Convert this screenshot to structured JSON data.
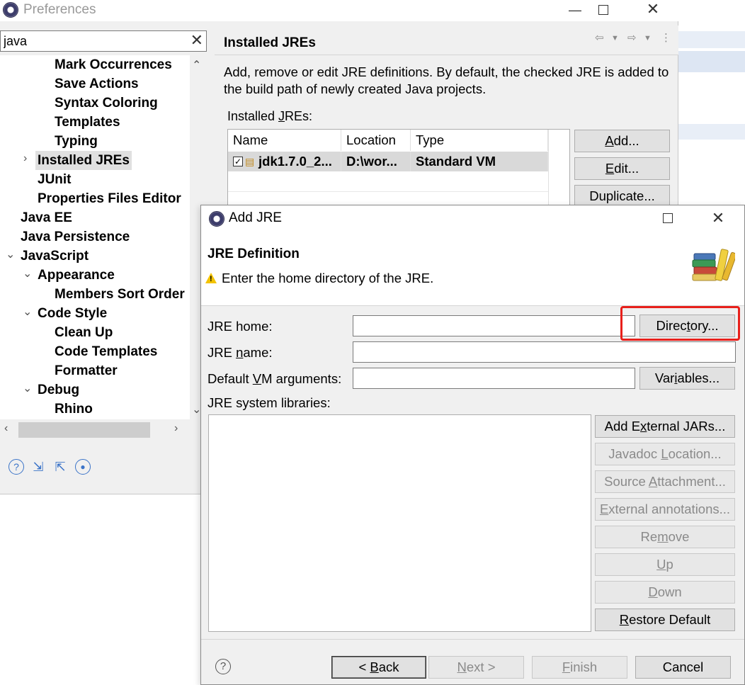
{
  "preferences": {
    "title": "Preferences",
    "filter_value": "java",
    "tree": [
      {
        "label": "Mark Occurrences"
      },
      {
        "label": "Save Actions"
      },
      {
        "label": "Syntax Coloring"
      },
      {
        "label": "Templates"
      },
      {
        "label": "Typing"
      },
      {
        "label": "Installed JREs"
      },
      {
        "label": "JUnit"
      },
      {
        "label": "Properties Files Editor"
      },
      {
        "label": "Java EE"
      },
      {
        "label": "Java Persistence"
      },
      {
        "label": "JavaScript"
      },
      {
        "label": "Appearance"
      },
      {
        "label": "Members Sort Order"
      },
      {
        "label": "Code Style"
      },
      {
        "label": "Clean Up"
      },
      {
        "label": "Code Templates"
      },
      {
        "label": "Formatter"
      },
      {
        "label": "Debug"
      },
      {
        "label": "Rhino"
      }
    ],
    "page": {
      "title": "Installed JREs",
      "description": "Add, remove or edit JRE definitions. By default, the checked JRE is added to the build path of newly created Java projects.",
      "installed_label_pre": "Installed ",
      "installed_label_mnemonic": "J",
      "installed_label_post": "REs:",
      "columns": [
        "Name",
        "Location",
        "Type"
      ],
      "rows": [
        {
          "name": "jdk1.7.0_2...",
          "location": "D:\\wor...",
          "type": "Standard VM",
          "checked": true
        }
      ],
      "buttons": {
        "add_mn": "A",
        "add_rest": "dd...",
        "edit_mn": "E",
        "edit_rest": "dit...",
        "duplicate": "Duplicate..."
      }
    }
  },
  "dialog": {
    "title": "Add JRE",
    "heading": "JRE Definition",
    "message": "Enter the home directory of the JRE.",
    "jre_home_label": "JRE home:",
    "jre_home_value": "",
    "jre_name_pre": "JRE ",
    "jre_name_mn": "n",
    "jre_name_post": "ame:",
    "jre_name_value": "",
    "vm_args_pre": "Default ",
    "vm_args_mn": "V",
    "vm_args_post": "M arguments:",
    "vm_args_value": "",
    "libraries_label": "JRE system libraries:",
    "buttons": {
      "directory_pre": "Direc",
      "directory_mn": "t",
      "directory_post": "ory...",
      "variables_pre": "Var",
      "variables_mn": "i",
      "variables_post": "ables...",
      "add_ext_pre": "Add E",
      "add_ext_mn": "x",
      "add_ext_post": "ternal JARs...",
      "javadoc_pre": "Javadoc ",
      "javadoc_mn": "L",
      "javadoc_post": "ocation...",
      "source_pre": "Source ",
      "source_mn": "A",
      "source_post": "ttachment...",
      "external_pre": "E",
      "external_mn": "x",
      "external_post": "ternal annotations...",
      "remove_pre": "Re",
      "remove_mn": "m",
      "remove_post": "ove",
      "up_mn": "U",
      "up_post": "p",
      "down_mn": "D",
      "down_post": "own",
      "restore_mn": "R",
      "restore_post": "estore Default",
      "back_pre": "< ",
      "back_mn": "B",
      "back_post": "ack",
      "next_mn": "N",
      "next_post": "ext >",
      "finish_mn": "F",
      "finish_post": "inish",
      "cancel": "Cancel"
    }
  },
  "colors": {
    "highlight": "#e8201b",
    "warning": "#f3c300"
  }
}
